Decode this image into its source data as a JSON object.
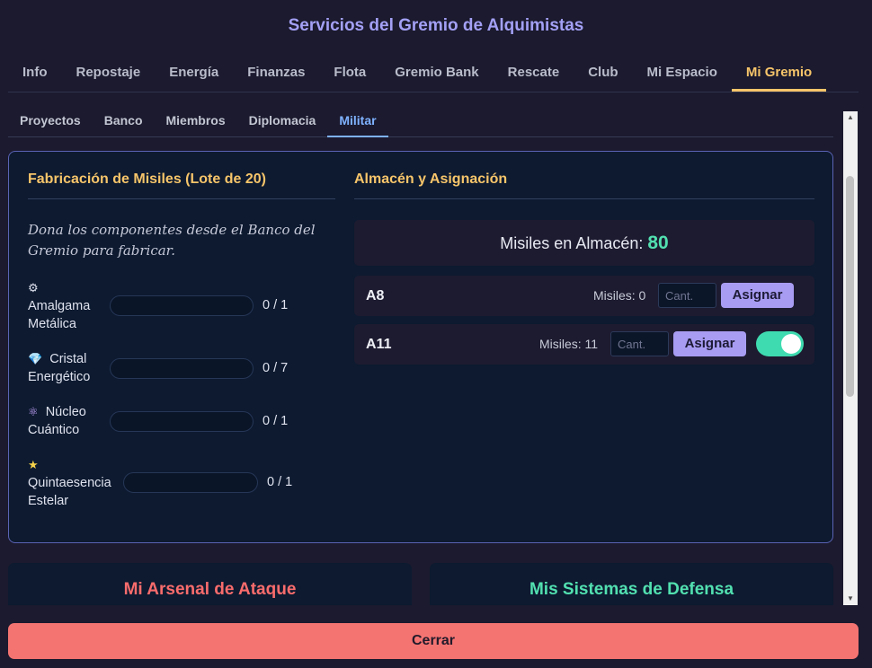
{
  "window": {
    "title": "Servicios del Gremio de Alquimistas"
  },
  "main_tabs": [
    {
      "label": "Info"
    },
    {
      "label": "Repostaje"
    },
    {
      "label": "Energía"
    },
    {
      "label": "Finanzas"
    },
    {
      "label": "Flota"
    },
    {
      "label": "Gremio Bank"
    },
    {
      "label": "Rescate"
    },
    {
      "label": "Club"
    },
    {
      "label": "Mi Espacio"
    },
    {
      "label": "Mi Gremio"
    }
  ],
  "active_main_tab": "Mi Gremio",
  "sub_tabs": [
    {
      "label": "Proyectos"
    },
    {
      "label": "Banco"
    },
    {
      "label": "Miembros"
    },
    {
      "label": "Diplomacia"
    },
    {
      "label": "Militar"
    }
  ],
  "active_sub_tab": "Militar",
  "fabrication": {
    "title": "Fabricación de Misiles (Lote de 20)",
    "description": "Dona los componentes desde el Banco del Gremio para fabricar.",
    "components": [
      {
        "icon": "gear-icon",
        "glyph": "⚙",
        "name": "Amalgama Metálica",
        "count": "0 / 1"
      },
      {
        "icon": "gem-icon",
        "glyph": "💎",
        "name": "Cristal Energético",
        "count": "0 / 7"
      },
      {
        "icon": "atom-icon",
        "glyph": "⚛",
        "name": "Núcleo Cuántico",
        "count": "0 / 1"
      },
      {
        "icon": "star-icon",
        "glyph": "★",
        "name": "Quintaesencia Estelar",
        "count": "0 / 1"
      }
    ]
  },
  "storage": {
    "title": "Almacén y Asignación",
    "stock_label": "Misiles en Almacén:",
    "stock_value": "80",
    "rows": [
      {
        "name": "A8",
        "missiles": "Misiles: 0",
        "qty_placeholder": "Cant.",
        "button": "Asignar",
        "toggle": null
      },
      {
        "name": "A11",
        "missiles": "Misiles: 11",
        "qty_placeholder": "Cant.",
        "button": "Asignar",
        "toggle": "on"
      }
    ]
  },
  "cards": {
    "attack": "Mi Arsenal de Ataque",
    "defense": "Mis Sistemas de Defensa"
  },
  "close_label": "Cerrar",
  "colors": {
    "accent_gold": "#f7c56a",
    "accent_blue": "#7fb2ff",
    "button_purple": "#a79cf2",
    "teal": "#52e0b0",
    "close_red": "#f47472"
  }
}
